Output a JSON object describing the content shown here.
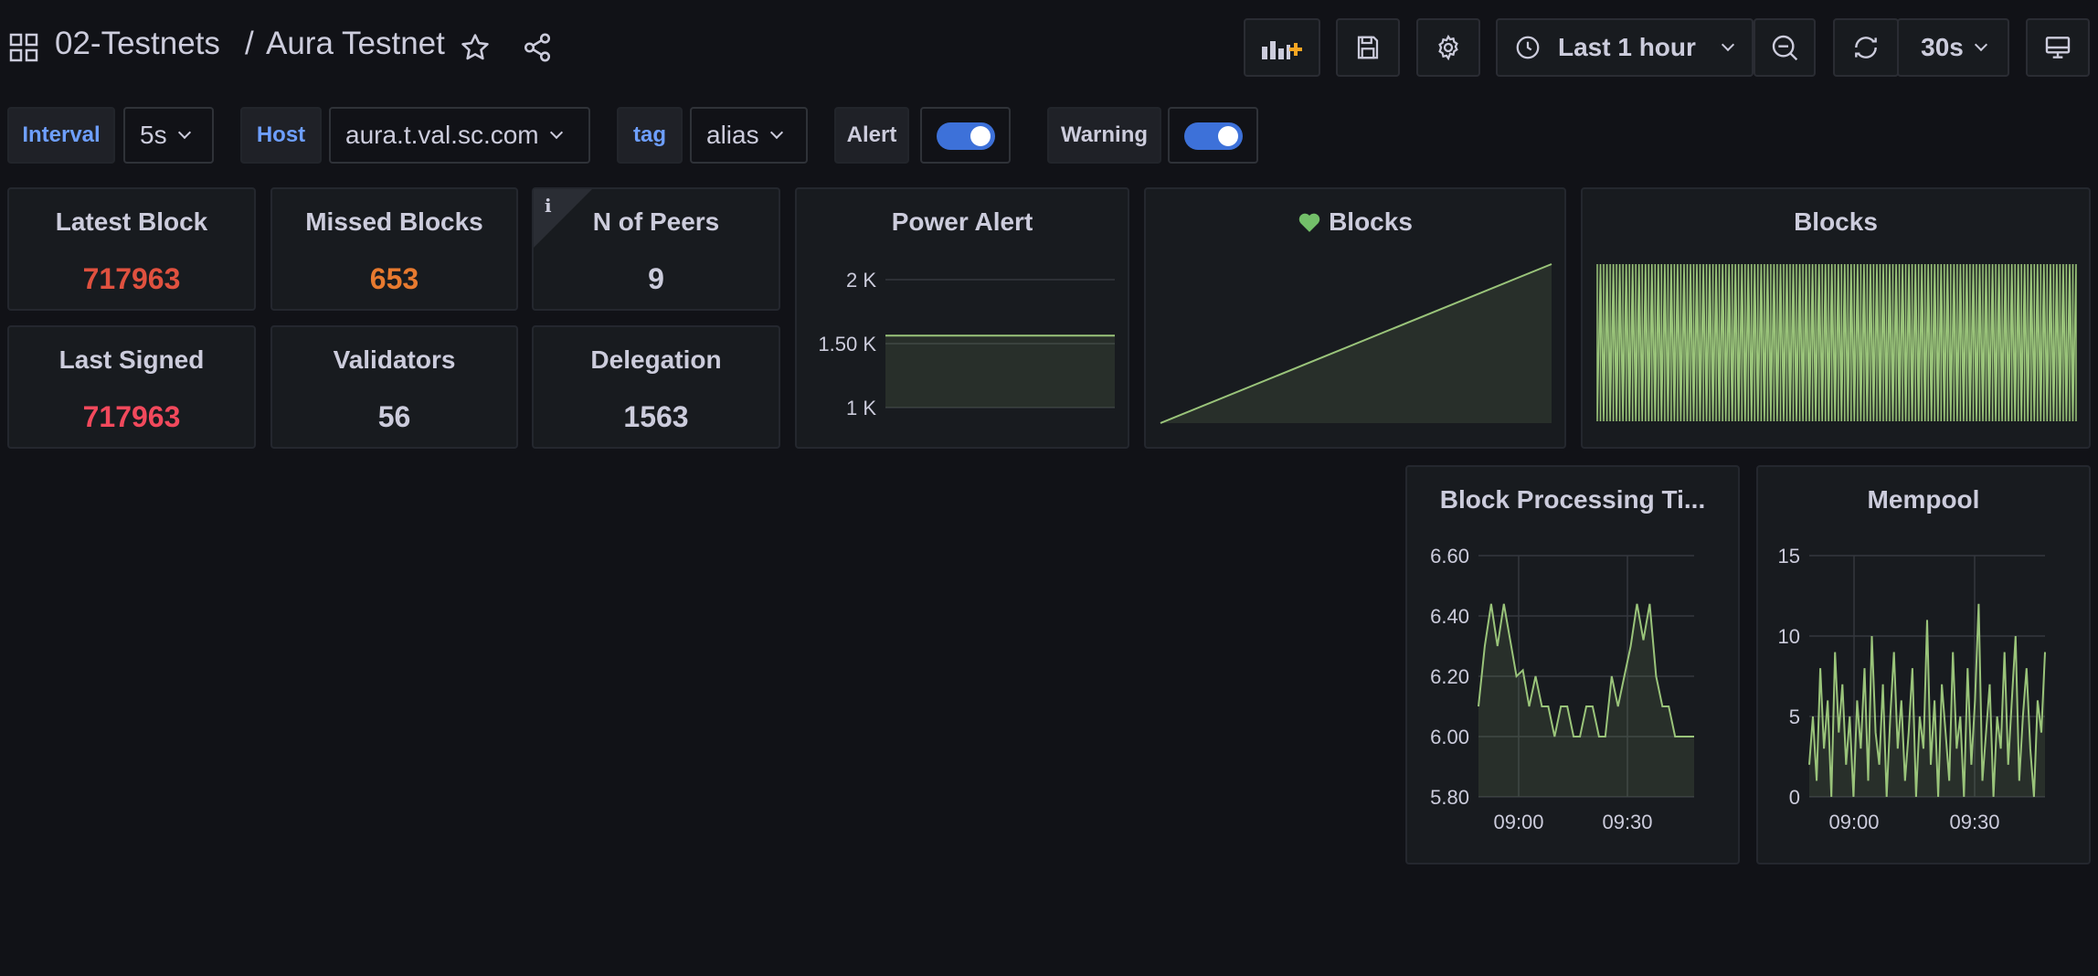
{
  "header": {
    "folder": "02-Testnets",
    "separator": "/",
    "title": "Aura Testnet",
    "time_range": "Last 1 hour",
    "refresh_interval": "30s"
  },
  "variables": {
    "interval": {
      "label": "Interval",
      "value": "5s"
    },
    "host": {
      "label": "Host",
      "value": "aura.t.val.sc.com"
    },
    "tag": {
      "label": "tag",
      "value": "alias"
    },
    "alert": {
      "label": "Alert",
      "enabled": true
    },
    "warning": {
      "label": "Warning",
      "enabled": true
    }
  },
  "stats": {
    "latest_block": {
      "title": "Latest Block",
      "value": "717963",
      "color": "#e0513f"
    },
    "missed_blocks": {
      "title": "Missed Blocks",
      "value": "653",
      "color": "#e77a2f"
    },
    "n_of_peers": {
      "title": "N of Peers",
      "value": "9",
      "color": "#ccccdc",
      "info": "i"
    },
    "last_signed": {
      "title": "Last Signed",
      "value": "717963",
      "color": "#f2495c"
    },
    "validators": {
      "title": "Validators",
      "value": "56",
      "color": "#ccccdc"
    },
    "delegation": {
      "title": "Delegation",
      "value": "1563",
      "color": "#ccccdc"
    }
  },
  "colors": {
    "series": "#9ac47a",
    "accent": "#6e9fff",
    "panel_bg": "#181b1f",
    "page_bg": "#111217",
    "heart": "#73bf69"
  },
  "panels": {
    "power_alert": {
      "title": "Power Alert",
      "chart_data": {
        "type": "area",
        "yticks": [
          "2 K",
          "1.50 K",
          "1 K"
        ],
        "ytick_values": [
          2000,
          1500,
          1000
        ],
        "ylim": [
          1000,
          2000
        ],
        "series": [
          {
            "values": [
              1563,
              1563,
              1563
            ]
          }
        ]
      }
    },
    "blocks_growth": {
      "title": "Blocks",
      "heart_icon": "heart-icon",
      "chart_data": {
        "type": "area",
        "series": [
          {
            "values": [
              0,
              1
            ]
          }
        ]
      }
    },
    "blocks_bars": {
      "title": "Blocks",
      "chart_data": {
        "type": "line",
        "note_pattern": "alternating",
        "bar_count": 150
      }
    },
    "block_processing": {
      "title": "Block Processing Ti...",
      "chart_data": {
        "type": "line",
        "yticks": [
          "6.60",
          "6.40",
          "6.20",
          "6.00",
          "5.80"
        ],
        "ytick_values": [
          6.6,
          6.4,
          6.2,
          6.0,
          5.8
        ],
        "ylim": [
          5.8,
          6.6
        ],
        "xticks": [
          "09:00",
          "09:30"
        ],
        "series": [
          {
            "values": [
              6.1,
              6.3,
              6.44,
              6.3,
              6.44,
              6.32,
              6.2,
              6.22,
              6.1,
              6.2,
              6.1,
              6.1,
              6.0,
              6.1,
              6.1,
              6.0,
              6.0,
              6.1,
              6.1,
              6.0,
              6.0,
              6.2,
              6.1,
              6.2,
              6.3,
              6.44,
              6.32,
              6.44,
              6.2,
              6.1,
              6.1,
              6.0,
              6.0,
              6.0,
              6.0
            ]
          }
        ]
      }
    },
    "mempool": {
      "title": "Mempool",
      "chart_data": {
        "type": "line",
        "yticks": [
          "15",
          "10",
          "5",
          "0"
        ],
        "ytick_values": [
          15,
          10,
          5,
          0
        ],
        "ylim": [
          0,
          15
        ],
        "xticks": [
          "09:00",
          "09:30"
        ],
        "series": [
          {
            "values": [
              2,
              5,
              1,
              8,
              3,
              6,
              0,
              9,
              4,
              7,
              2,
              5,
              0,
              6,
              3,
              8,
              1,
              10,
              4,
              2,
              7,
              0,
              5,
              9,
              3,
              6,
              1,
              4,
              8,
              0,
              5,
              3,
              11,
              2,
              6,
              0,
              7,
              4,
              1,
              9,
              3,
              5,
              0,
              8,
              2,
              6,
              12,
              1,
              4,
              7,
              0,
              5,
              3,
              9,
              2,
              6,
              10,
              1,
              5,
              8,
              3,
              0,
              6,
              4,
              9
            ]
          }
        ]
      }
    }
  }
}
